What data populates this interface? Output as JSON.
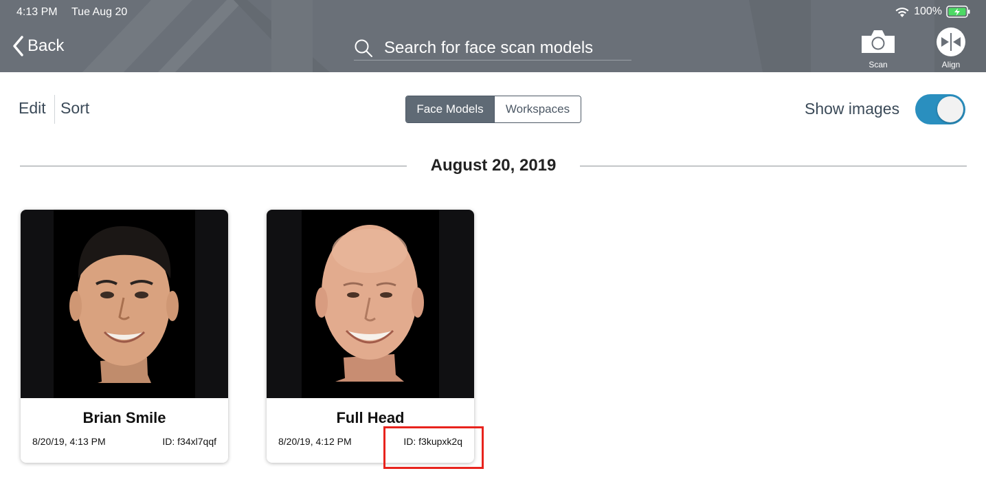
{
  "status_bar": {
    "time": "4:13 PM",
    "date": "Tue Aug 20",
    "battery_percent": "100%"
  },
  "nav": {
    "back_label": "Back",
    "search_placeholder": "Search for face scan models",
    "scan_label": "Scan",
    "align_label": "Align"
  },
  "toolbar": {
    "edit_label": "Edit",
    "sort_label": "Sort",
    "segments": [
      {
        "label": "Face Models",
        "active": true
      },
      {
        "label": "Workspaces",
        "active": false
      }
    ],
    "show_images_label": "Show images",
    "show_images_on": true
  },
  "section": {
    "date_header": "August 20, 2019"
  },
  "cards": [
    {
      "title": "Brian Smile",
      "date": "8/20/19, 4:13 PM",
      "id": "ID: f34xl7qqf"
    },
    {
      "title": "Full Head",
      "date": "8/20/19, 4:12 PM",
      "id": "ID: f3kupxk2q"
    }
  ],
  "colors": {
    "header_bg": "#6a7078",
    "accent": "#2a8fbf",
    "segment_active": "#5f6a75",
    "highlight": "#e8231d"
  }
}
